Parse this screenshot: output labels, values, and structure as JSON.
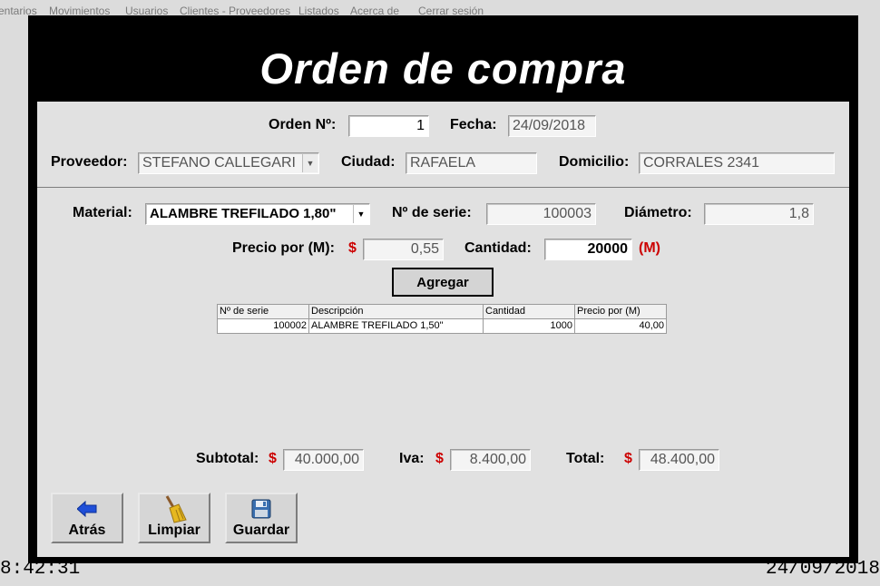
{
  "menu": [
    "entarios",
    "Movimientos",
    "Usuarios",
    "Clientes - Proveedores",
    "Listados",
    "Acerca de",
    "Cerrar sesión"
  ],
  "title": "Orden de compra",
  "orden": {
    "label": "Orden Nº:",
    "value": "1"
  },
  "fecha": {
    "label": "Fecha:",
    "value": "24/09/2018"
  },
  "proveedor": {
    "label": "Proveedor:",
    "value": "STEFANO CALLEGARI"
  },
  "ciudad": {
    "label": "Ciudad:",
    "value": "RAFAELA"
  },
  "domicilio": {
    "label": "Domicilio:",
    "value": "CORRALES 2341"
  },
  "material": {
    "label": "Material:",
    "value": "ALAMBRE TREFILADO 1,80\""
  },
  "serie": {
    "label": "Nº de serie:",
    "value": "100003"
  },
  "diametro": {
    "label": "Diámetro:",
    "value": "1,8"
  },
  "precio": {
    "label": "Precio por (M):",
    "currency": "$",
    "value": "0,55"
  },
  "cantidad": {
    "label": "Cantidad:",
    "value": "20000",
    "unit": "(M)"
  },
  "agregar_label": "Agregar",
  "table": {
    "headers": [
      "Nº de serie",
      "Descripción",
      "Cantidad",
      "Precio por (M)"
    ],
    "rows": [
      [
        "100002",
        "ALAMBRE TREFILADO 1,50\"",
        "1000",
        "40,00"
      ]
    ]
  },
  "totals": {
    "subtotal_label": "Subtotal:",
    "subtotal": "40.000,00",
    "iva_label": "Iva:",
    "iva": "8.400,00",
    "total_label": "Total:",
    "total": "48.400,00",
    "currency": "$"
  },
  "buttons": {
    "atras": "Atrás",
    "limpiar": "Limpiar",
    "guardar": "Guardar"
  },
  "icons": {
    "atras": "arrow-left-icon",
    "limpiar": "broom-icon",
    "guardar": "floppy-disk-icon"
  },
  "colors": {
    "accent_red": "#cc0000",
    "title_bg": "#000000",
    "arrow_blue": "#1f4fd8"
  },
  "status": {
    "time": "8:42:31",
    "date": "24/09/2018"
  }
}
